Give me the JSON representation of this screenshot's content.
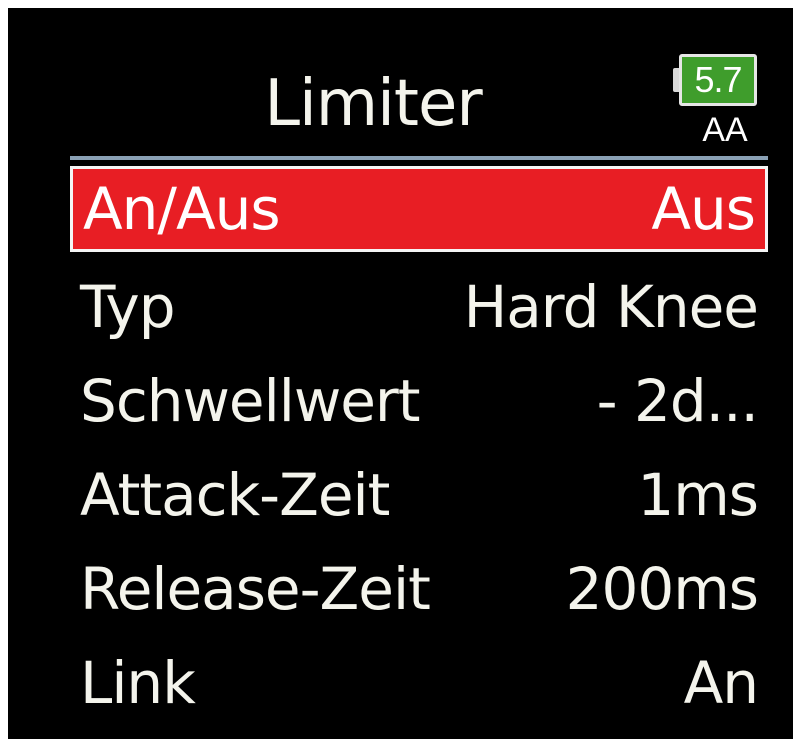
{
  "screen": {
    "title": "Limiter",
    "battery": {
      "value": "5.7",
      "type": "AA",
      "color": "#3f9d2c"
    }
  },
  "menu": {
    "items": [
      {
        "label": "An/Aus",
        "value": "Aus",
        "selected": true
      },
      {
        "label": "Typ",
        "value": "Hard Knee",
        "selected": false
      },
      {
        "label": "Schwellwert",
        "value": "- 2d...",
        "selected": false
      },
      {
        "label": "Attack-Zeit",
        "value": "1ms",
        "selected": false
      },
      {
        "label": "Release-Zeit",
        "value": "200ms",
        "selected": false
      },
      {
        "label": "Link",
        "value": "An",
        "selected": false
      }
    ]
  },
  "colors": {
    "background": "#000000",
    "selection": "#e81e24",
    "text": "#f4f4ec",
    "divider": "#8aa0b4"
  }
}
